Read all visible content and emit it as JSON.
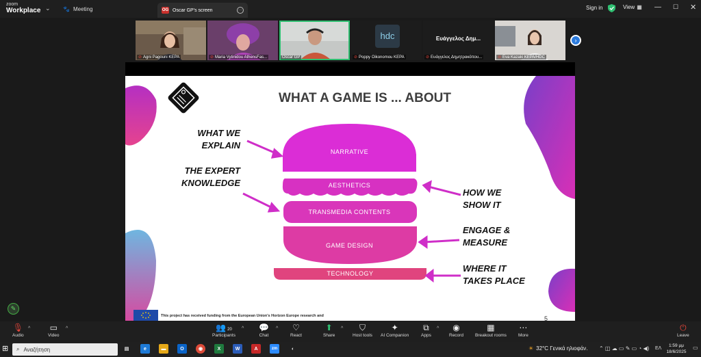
{
  "app": {
    "brand_small": "zoom",
    "brand_big": "Workplace",
    "meeting_label": "Meeting"
  },
  "share_tab": {
    "initials": "OG",
    "title": "Oscar GP's screen"
  },
  "top_right": {
    "signin": "Sign in",
    "view": "View"
  },
  "participants": [
    {
      "name": "Agni Pagouni KEPA",
      "muted": true
    },
    {
      "name": "Maria Vytinidou AthensFas...",
      "muted": true
    },
    {
      "name": "Oscar GP",
      "muted": false,
      "active": true
    },
    {
      "name": "Poppy Oikonomou KEPA",
      "muted": true
    },
    {
      "name": "Ευάγγελος Δημητρακόπου...",
      "muted": true,
      "display": "Ευάγγελος Δημ..."
    },
    {
      "name": "Eva Kazaki KEPA/HDC",
      "muted": true
    }
  ],
  "slide": {
    "title": "WHAT A GAME IS ... ABOUT",
    "left_labels": [
      {
        "line1": "WHAT WE",
        "line2": "EXPLAIN"
      },
      {
        "line1": "THE EXPERT",
        "line2": "KNOWLEDGE"
      }
    ],
    "right_labels": [
      {
        "line1": "HOW WE",
        "line2": "SHOW IT"
      },
      {
        "line1": "ENGAGE &",
        "line2": "MEASURE"
      },
      {
        "line1": "WHERE IT",
        "line2": "TAKES PLACE"
      }
    ],
    "layers": [
      "NARRATIVE",
      "AESTHETICS",
      "TRANSMEDIA CONTENTS",
      "GAME DESIGN",
      "TECHNOLOGY"
    ],
    "funding": "This project has received funding from the European Union's Horizon Europe research and",
    "page_number": "5",
    "hdc_logo": "hdc"
  },
  "toolbar": {
    "audio": "Audio",
    "video": "Video",
    "participants": "Participants",
    "participants_count": "20",
    "chat": "Chat",
    "react": "React",
    "share": "Share",
    "host_tools": "Host tools",
    "ai_companion": "AI Companion",
    "apps": "Apps",
    "record": "Record",
    "breakout_rooms": "Breakout rooms",
    "more": "More",
    "leave": "Leave"
  },
  "taskbar": {
    "search_placeholder": "Αναζήτηση",
    "weather": "32°C  Γενικά ηλιοφάν.",
    "lang": "ΕΛ",
    "time": "1:59 μμ",
    "date": "18/6/2025"
  },
  "colors": {
    "magenta": "#d62fd2",
    "pink": "#e0407a",
    "accent_green": "#2fbf71"
  }
}
